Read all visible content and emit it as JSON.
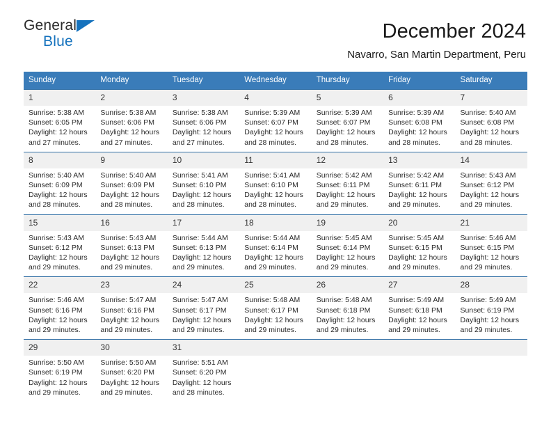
{
  "brand": {
    "line1": "General",
    "line2": "Blue",
    "mark": "triangle-icon"
  },
  "header": {
    "title": "December 2024",
    "subtitle": "Navarro, San Martin Department, Peru"
  },
  "colors": {
    "header_blue": "#3a7cb9",
    "row_rule_blue": "#2e6da4",
    "daynum_band": "#f0f0f0",
    "brand_blue": "#1572bd",
    "text": "#2b2b2b"
  },
  "weekdays": [
    "Sunday",
    "Monday",
    "Tuesday",
    "Wednesday",
    "Thursday",
    "Friday",
    "Saturday"
  ],
  "weeks": [
    {
      "days": [
        {
          "num": "1",
          "l1": "Sunrise: 5:38 AM",
          "l2": "Sunset: 6:05 PM",
          "l3": "Daylight: 12 hours",
          "l4": "and 27 minutes."
        },
        {
          "num": "2",
          "l1": "Sunrise: 5:38 AM",
          "l2": "Sunset: 6:06 PM",
          "l3": "Daylight: 12 hours",
          "l4": "and 27 minutes."
        },
        {
          "num": "3",
          "l1": "Sunrise: 5:38 AM",
          "l2": "Sunset: 6:06 PM",
          "l3": "Daylight: 12 hours",
          "l4": "and 27 minutes."
        },
        {
          "num": "4",
          "l1": "Sunrise: 5:39 AM",
          "l2": "Sunset: 6:07 PM",
          "l3": "Daylight: 12 hours",
          "l4": "and 28 minutes."
        },
        {
          "num": "5",
          "l1": "Sunrise: 5:39 AM",
          "l2": "Sunset: 6:07 PM",
          "l3": "Daylight: 12 hours",
          "l4": "and 28 minutes."
        },
        {
          "num": "6",
          "l1": "Sunrise: 5:39 AM",
          "l2": "Sunset: 6:08 PM",
          "l3": "Daylight: 12 hours",
          "l4": "and 28 minutes."
        },
        {
          "num": "7",
          "l1": "Sunrise: 5:40 AM",
          "l2": "Sunset: 6:08 PM",
          "l3": "Daylight: 12 hours",
          "l4": "and 28 minutes."
        }
      ]
    },
    {
      "days": [
        {
          "num": "8",
          "l1": "Sunrise: 5:40 AM",
          "l2": "Sunset: 6:09 PM",
          "l3": "Daylight: 12 hours",
          "l4": "and 28 minutes."
        },
        {
          "num": "9",
          "l1": "Sunrise: 5:40 AM",
          "l2": "Sunset: 6:09 PM",
          "l3": "Daylight: 12 hours",
          "l4": "and 28 minutes."
        },
        {
          "num": "10",
          "l1": "Sunrise: 5:41 AM",
          "l2": "Sunset: 6:10 PM",
          "l3": "Daylight: 12 hours",
          "l4": "and 28 minutes."
        },
        {
          "num": "11",
          "l1": "Sunrise: 5:41 AM",
          "l2": "Sunset: 6:10 PM",
          "l3": "Daylight: 12 hours",
          "l4": "and 28 minutes."
        },
        {
          "num": "12",
          "l1": "Sunrise: 5:42 AM",
          "l2": "Sunset: 6:11 PM",
          "l3": "Daylight: 12 hours",
          "l4": "and 29 minutes."
        },
        {
          "num": "13",
          "l1": "Sunrise: 5:42 AM",
          "l2": "Sunset: 6:11 PM",
          "l3": "Daylight: 12 hours",
          "l4": "and 29 minutes."
        },
        {
          "num": "14",
          "l1": "Sunrise: 5:43 AM",
          "l2": "Sunset: 6:12 PM",
          "l3": "Daylight: 12 hours",
          "l4": "and 29 minutes."
        }
      ]
    },
    {
      "days": [
        {
          "num": "15",
          "l1": "Sunrise: 5:43 AM",
          "l2": "Sunset: 6:12 PM",
          "l3": "Daylight: 12 hours",
          "l4": "and 29 minutes."
        },
        {
          "num": "16",
          "l1": "Sunrise: 5:43 AM",
          "l2": "Sunset: 6:13 PM",
          "l3": "Daylight: 12 hours",
          "l4": "and 29 minutes."
        },
        {
          "num": "17",
          "l1": "Sunrise: 5:44 AM",
          "l2": "Sunset: 6:13 PM",
          "l3": "Daylight: 12 hours",
          "l4": "and 29 minutes."
        },
        {
          "num": "18",
          "l1": "Sunrise: 5:44 AM",
          "l2": "Sunset: 6:14 PM",
          "l3": "Daylight: 12 hours",
          "l4": "and 29 minutes."
        },
        {
          "num": "19",
          "l1": "Sunrise: 5:45 AM",
          "l2": "Sunset: 6:14 PM",
          "l3": "Daylight: 12 hours",
          "l4": "and 29 minutes."
        },
        {
          "num": "20",
          "l1": "Sunrise: 5:45 AM",
          "l2": "Sunset: 6:15 PM",
          "l3": "Daylight: 12 hours",
          "l4": "and 29 minutes."
        },
        {
          "num": "21",
          "l1": "Sunrise: 5:46 AM",
          "l2": "Sunset: 6:15 PM",
          "l3": "Daylight: 12 hours",
          "l4": "and 29 minutes."
        }
      ]
    },
    {
      "days": [
        {
          "num": "22",
          "l1": "Sunrise: 5:46 AM",
          "l2": "Sunset: 6:16 PM",
          "l3": "Daylight: 12 hours",
          "l4": "and 29 minutes."
        },
        {
          "num": "23",
          "l1": "Sunrise: 5:47 AM",
          "l2": "Sunset: 6:16 PM",
          "l3": "Daylight: 12 hours",
          "l4": "and 29 minutes."
        },
        {
          "num": "24",
          "l1": "Sunrise: 5:47 AM",
          "l2": "Sunset: 6:17 PM",
          "l3": "Daylight: 12 hours",
          "l4": "and 29 minutes."
        },
        {
          "num": "25",
          "l1": "Sunrise: 5:48 AM",
          "l2": "Sunset: 6:17 PM",
          "l3": "Daylight: 12 hours",
          "l4": "and 29 minutes."
        },
        {
          "num": "26",
          "l1": "Sunrise: 5:48 AM",
          "l2": "Sunset: 6:18 PM",
          "l3": "Daylight: 12 hours",
          "l4": "and 29 minutes."
        },
        {
          "num": "27",
          "l1": "Sunrise: 5:49 AM",
          "l2": "Sunset: 6:18 PM",
          "l3": "Daylight: 12 hours",
          "l4": "and 29 minutes."
        },
        {
          "num": "28",
          "l1": "Sunrise: 5:49 AM",
          "l2": "Sunset: 6:19 PM",
          "l3": "Daylight: 12 hours",
          "l4": "and 29 minutes."
        }
      ]
    },
    {
      "days": [
        {
          "num": "29",
          "l1": "Sunrise: 5:50 AM",
          "l2": "Sunset: 6:19 PM",
          "l3": "Daylight: 12 hours",
          "l4": "and 29 minutes."
        },
        {
          "num": "30",
          "l1": "Sunrise: 5:50 AM",
          "l2": "Sunset: 6:20 PM",
          "l3": "Daylight: 12 hours",
          "l4": "and 29 minutes."
        },
        {
          "num": "31",
          "l1": "Sunrise: 5:51 AM",
          "l2": "Sunset: 6:20 PM",
          "l3": "Daylight: 12 hours",
          "l4": "and 28 minutes."
        },
        {
          "num": "",
          "l1": "",
          "l2": "",
          "l3": "",
          "l4": ""
        },
        {
          "num": "",
          "l1": "",
          "l2": "",
          "l3": "",
          "l4": ""
        },
        {
          "num": "",
          "l1": "",
          "l2": "",
          "l3": "",
          "l4": ""
        },
        {
          "num": "",
          "l1": "",
          "l2": "",
          "l3": "",
          "l4": ""
        }
      ]
    }
  ]
}
